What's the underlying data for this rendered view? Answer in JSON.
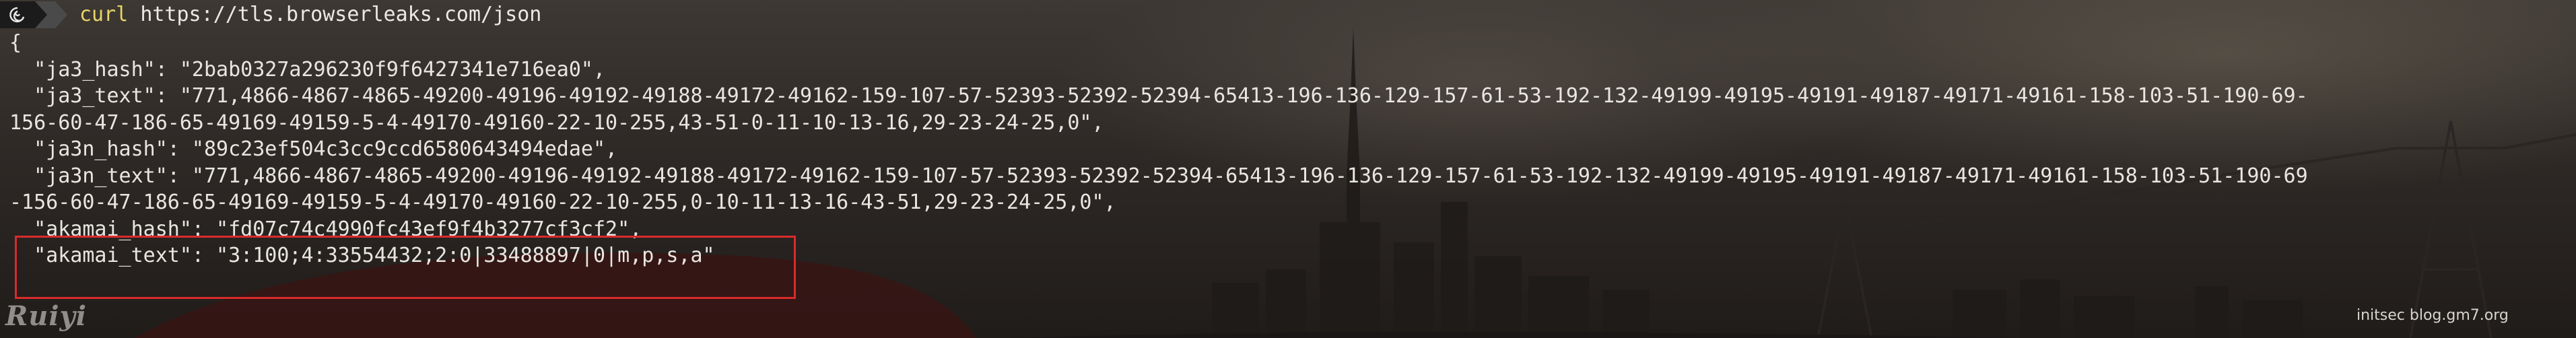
{
  "prompt": {
    "icon": "debian-swirl-icon",
    "command": "curl",
    "argument": "https://tls.browserleaks.com/json"
  },
  "json_lines": [
    "{",
    "  \"ja3_hash\": \"2bab0327a296230f9f6427341e716ea0\",",
    "  \"ja3_text\": \"771,4866-4867-4865-49200-49196-49192-49188-49172-49162-159-107-57-52393-52392-52394-65413-196-136-129-157-61-53-192-132-49199-49195-49191-49187-49171-49161-158-103-51-190-69-",
    "156-60-47-186-65-49169-49159-5-4-49170-49160-22-10-255,43-51-0-11-10-13-16,29-23-24-25,0\",",
    "  \"ja3n_hash\": \"89c23ef504c3cc9ccd6580643494edae\",",
    "  \"ja3n_text\": \"771,4866-4867-4865-49200-49196-49192-49188-49172-49162-159-107-57-52393-52392-52394-65413-196-136-129-157-61-53-192-132-49199-49195-49191-49187-49171-49161-158-103-51-190-69",
    "-156-60-47-186-65-49169-49159-5-4-49170-49160-22-10-255,0-10-11-13-16-43-51,29-23-24-25,0\",",
    "  \"akamai_hash\": \"fd07c74c4990fc43ef9f4b3277cf3cf2\",",
    "  \"akamai_text\": \"3:100;4:33554432;2:0|33488897|0|m,p,s,a\""
  ],
  "watermark": "initsec blog.gm7.org",
  "logo_text": "Ruiyi",
  "colors": {
    "command": "#e8d36a",
    "text": "#e9e6e1",
    "highlight_border": "#d92b2b"
  }
}
